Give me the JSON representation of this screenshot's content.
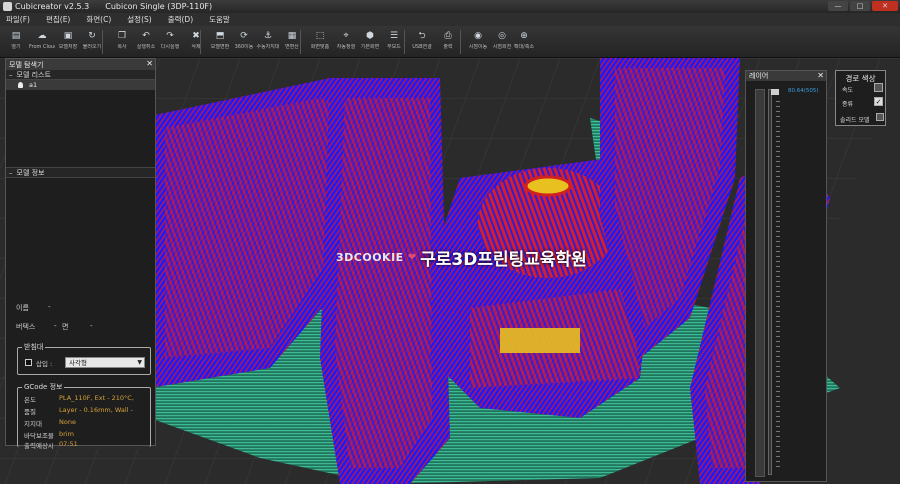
{
  "window": {
    "app_title": "Cubicreator v2.5.3",
    "doc_title": "Cubicon Single (3DP-110F)"
  },
  "menu": [
    "파일(F)",
    "편집(E)",
    "화면(C)",
    "설정(S)",
    "출력(D)",
    "도움말"
  ],
  "toolbar": [
    {
      "label": "열기",
      "icon": "folder-icon"
    },
    {
      "label": "From Cloud",
      "icon": "cloud-icon"
    },
    {
      "label": "모델저장",
      "icon": "save-icon"
    },
    {
      "label": "불러오기",
      "icon": "reload-icon"
    },
    {
      "label": "복사",
      "icon": "copy-icon"
    },
    {
      "label": "실행취소",
      "icon": "undo-icon"
    },
    {
      "label": "다시실행",
      "icon": "redo-icon"
    },
    {
      "label": "삭제",
      "icon": "delete-icon"
    },
    {
      "label": "모델변환",
      "icon": "convert-icon"
    },
    {
      "label": "360이동",
      "icon": "rotate-icon"
    },
    {
      "label": "수동지지대",
      "icon": "support-icon"
    },
    {
      "label": "면환산",
      "icon": "face-icon"
    },
    {
      "label": "화면맞춤",
      "icon": "fit-icon"
    },
    {
      "label": "자동정렬",
      "icon": "align-icon"
    },
    {
      "label": "기본화면",
      "icon": "cube-icon"
    },
    {
      "label": "부모드",
      "icon": "layer-icon"
    },
    {
      "label": "USB연결",
      "icon": "usb-icon"
    },
    {
      "label": "출력",
      "icon": "print-icon"
    },
    {
      "label": "시점이동",
      "icon": "camera-icon"
    },
    {
      "label": "시점회전",
      "icon": "camera-rotate-icon"
    },
    {
      "label": "확대/축소",
      "icon": "zoom-icon"
    }
  ],
  "left_panel": {
    "title": "모델 탐색기",
    "list_section": "모델 리스트",
    "model_name": "a1",
    "info_section": "모델 정보",
    "name_label": "이름",
    "name_value": "-",
    "vertex_label": "버텍스",
    "vertex_value": "-",
    "face_label": "면",
    "face_value": "-",
    "mount": {
      "legend": "받침대",
      "insert_label": "삽입 :",
      "shape_value": "사각형"
    },
    "gcode": {
      "legend": "GCode 정보",
      "temp_label": "온도",
      "temp_value": "PLA_110F, Ext - 210°C,",
      "quality_label": "품질",
      "quality_value": "Layer - 0.16mm, Wall -",
      "support_label": "지지대",
      "support_value": "None",
      "adhesion_label": "바닥보조물",
      "adhesion_value": "brim",
      "time_label": "출력예상시",
      "time_value": "07:51"
    }
  },
  "layer_panel": {
    "title": "레이어",
    "value": "80.64(505)"
  },
  "path_panel": {
    "title": "경로 색상",
    "speed_label": "속도",
    "type_label": "종류",
    "solid_label": "솔리드 모델"
  },
  "watermark": {
    "brand": "3DCOOKIE",
    "text": "구로3D프린팅교육학원"
  },
  "colors": {
    "wall_blue": "#1a1aff",
    "infill_red": "#e02020",
    "brim_green": "#2aa882",
    "top_yellow": "#e8c020"
  }
}
